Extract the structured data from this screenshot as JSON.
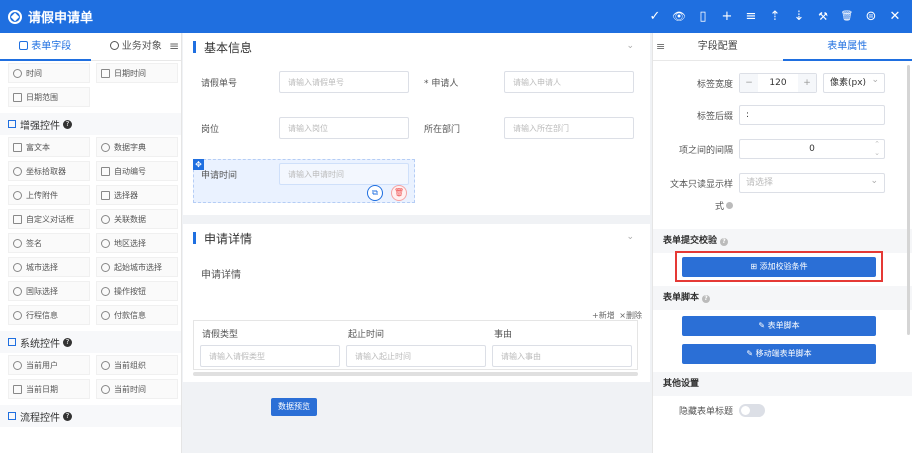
{
  "app": {
    "title": "请假申请单"
  },
  "toolbar": {
    "icons": [
      "check-icon",
      "eye-icon",
      "mobile-icon",
      "plus-icon",
      "list-icon",
      "upload-icon",
      "download-icon",
      "wrench-icon",
      "delete-icon",
      "save-icon",
      "close-icon"
    ],
    "glyphs": [
      "✓",
      "👁",
      "▯",
      "+",
      "≡",
      "⇡",
      "⇣",
      "⚒",
      "🗑",
      "⊜",
      "✕"
    ]
  },
  "left": {
    "tabs": [
      "表单字段",
      "业务对象"
    ],
    "top_items": [
      "时间",
      "日期时间",
      "日期范围"
    ],
    "groups": [
      {
        "title": "增强控件",
        "items": [
          "富文本",
          "数据字典",
          "坐标拾取器",
          "自动编号",
          "上传附件",
          "选择器",
          "自定义对话框",
          "关联数据",
          "签名",
          "地区选择",
          "城市选择",
          "起始城市选择",
          "国际选择",
          "操作按钮",
          "行程信息",
          "付款信息"
        ]
      },
      {
        "title": "系统控件",
        "items": [
          "当前用户",
          "当前组织",
          "当前日期",
          "当前时间"
        ]
      },
      {
        "title": "流程控件",
        "items": []
      }
    ]
  },
  "canvas": {
    "section1": {
      "title": "基本信息",
      "fields": [
        {
          "label": "请假单号",
          "placeholder": "请输入请假单号"
        },
        {
          "label": "* 申请人",
          "placeholder": "请输入申请人"
        },
        {
          "label": "岗位",
          "placeholder": "请输入岗位"
        },
        {
          "label": "所在部门",
          "placeholder": "请输入所在部门"
        },
        {
          "label": "申请时间",
          "placeholder": "请输入申请时间"
        }
      ]
    },
    "section2": {
      "title": "申请详情",
      "subtable_label": "申请详情",
      "add_label": "+新增",
      "delete_label": "×删除",
      "columns": [
        "请假类型",
        "起止时间",
        "事由"
      ],
      "placeholders": [
        "请输入请假类型",
        "请输入起止时间",
        "请输入事由"
      ]
    },
    "preview_button": "数据预览"
  },
  "right": {
    "tabs": [
      "字段配置",
      "表单属性"
    ],
    "label_width_label": "标签宽度",
    "label_width_value": "120",
    "label_width_unit": "像素(px)",
    "label_suffix_label": "标签后缀",
    "label_suffix_value": ":",
    "item_gap_label": "项之间的间隔",
    "item_gap_value": "0",
    "readonly_style_label": "文本只读显示样",
    "readonly_style_label2": "式",
    "readonly_style_placeholder": "请选择",
    "submit_check_title": "表单提交校验",
    "add_check_button": "添加校验条件",
    "script_title": "表单脚本",
    "script_button": "表单脚本",
    "mobile_script_button": "移动端表单脚本",
    "other_title": "其他设置",
    "hide_title_label": "隐藏表单标题"
  }
}
